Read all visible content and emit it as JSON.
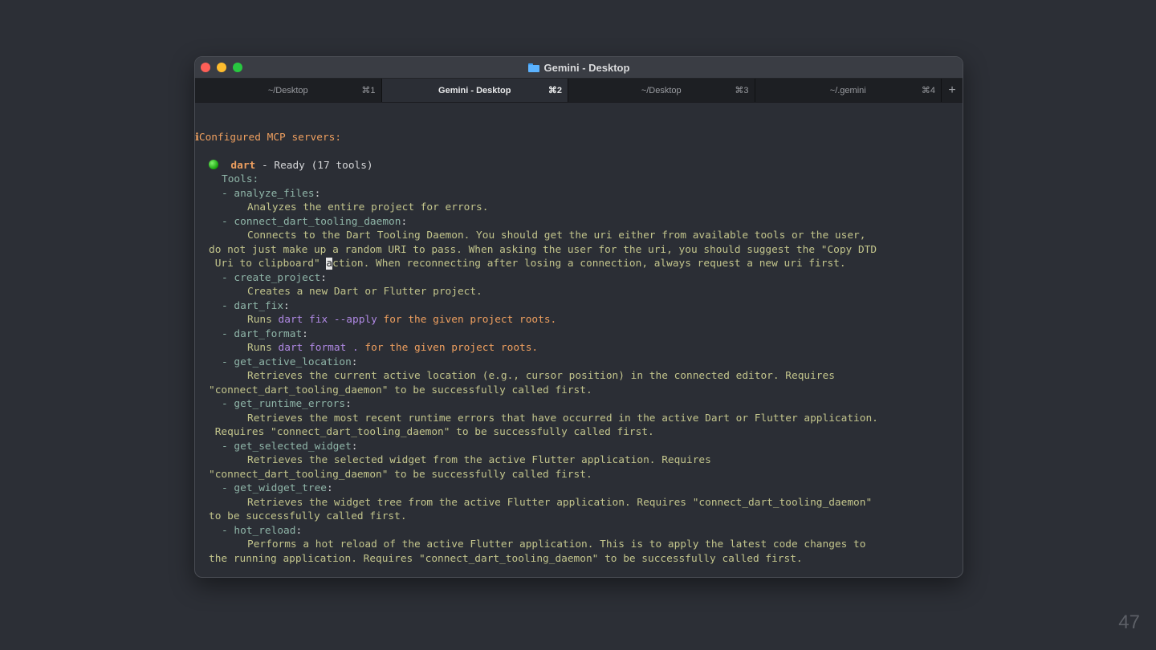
{
  "window": {
    "title": "Gemini - Desktop",
    "title_icon": "folder-icon"
  },
  "tabs": [
    {
      "label": "~/Desktop",
      "shortcut": "⌘1",
      "active": false
    },
    {
      "label": "Gemini - Desktop",
      "shortcut": "⌘2",
      "active": true
    },
    {
      "label": "~/Desktop",
      "shortcut": "⌘3",
      "active": false
    },
    {
      "label": "~/.gemini",
      "shortcut": "⌘4",
      "active": false
    }
  ],
  "tab_add_label": "+",
  "terminal": {
    "info_icon": "ℹ",
    "header": "Configured MCP servers:",
    "server": {
      "name": "dart",
      "status": " - Ready (17 tools)",
      "tools_label": "Tools:"
    },
    "lines": {
      "l03a": "- analyze_files",
      "l03b": ":",
      "l04": "Analyzes the entire project for errors.",
      "l05a": "- connect_dart_tooling_daemon",
      "l05b": ":",
      "l06": "Connects to the Dart Tooling Daemon. You should get the uri either from available tools or the user,",
      "l07": "do not just make up a random URI to pass. When asking the user for the uri, you should suggest the \"Copy DTD",
      "l08a": " Uri to clipboard\" ",
      "l08_cursor": "a",
      "l08b": "ction. When reconnecting after losing a connection, always request a new uri first.",
      "l09a": "- create_project",
      "l09b": ":",
      "l10": "Creates a new Dart or Flutter project.",
      "l11a": "- dart_fix",
      "l11b": ":",
      "l12a": "Runs ",
      "l12_cmd": "dart fix --apply",
      "l12b": " for the given project roots.",
      "l13a": "- dart_format",
      "l13b": ":",
      "l14a": "Runs ",
      "l14_cmd": "dart format .",
      "l14b": " for the given project roots.",
      "l15a": "- get_active_location",
      "l15b": ":",
      "l16": "Retrieves the current active location (e.g., cursor position) in the connected editor. Requires",
      "l17": "\"connect_dart_tooling_daemon\" to be successfully called first.",
      "l18a": "- get_runtime_errors",
      "l18b": ":",
      "l19": "Retrieves the most recent runtime errors that have occurred in the active Dart or Flutter application.",
      "l20": " Requires \"connect_dart_tooling_daemon\" to be successfully called first.",
      "l21a": "- get_selected_widget",
      "l21b": ":",
      "l22": "Retrieves the selected widget from the active Flutter application. Requires",
      "l23": "\"connect_dart_tooling_daemon\" to be successfully called first.",
      "l24a": "- get_widget_tree",
      "l24b": ":",
      "l25": "Retrieves the widget tree from the active Flutter application. Requires \"connect_dart_tooling_daemon\"",
      "l26": "to be successfully called first.",
      "l27a": "- hot_reload",
      "l27b": ":",
      "l28": "Performs a hot reload of the active Flutter application. This is to apply the latest code changes to",
      "l29": "the running application. Requires \"connect_dart_tooling_daemon\" to be successfully called first."
    }
  },
  "page_number": "47"
}
